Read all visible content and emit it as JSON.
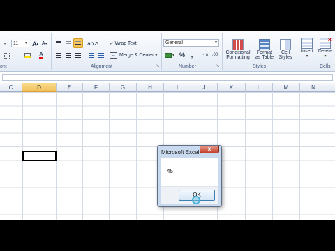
{
  "ribbon": {
    "font_label": "ont",
    "font_size": "11",
    "wrap_text": "Wrap Text",
    "merge_center": "Merge & Center",
    "alignment_label": "Alignment",
    "number_format": "General",
    "number_label": "Number",
    "percent": "%",
    "comma": ",",
    "conditional_line1": "Conditional",
    "conditional_line2": "Formatting",
    "format_table_line1": "Format",
    "format_table_line2": "as Table",
    "cell_styles_line1": "Cell",
    "cell_styles_line2": "Styles",
    "styles_label": "Styles",
    "insert": "Insert",
    "delete": "Delete",
    "cells_label": "Cells"
  },
  "columns": [
    "C",
    "D",
    "E",
    "F",
    "G",
    "H",
    "I",
    "J",
    "K",
    "L",
    "M",
    "N"
  ],
  "selected_column": "D",
  "dialog": {
    "title": "Microsoft Excel",
    "close": "x",
    "message": "45",
    "ok_label": "OK"
  }
}
